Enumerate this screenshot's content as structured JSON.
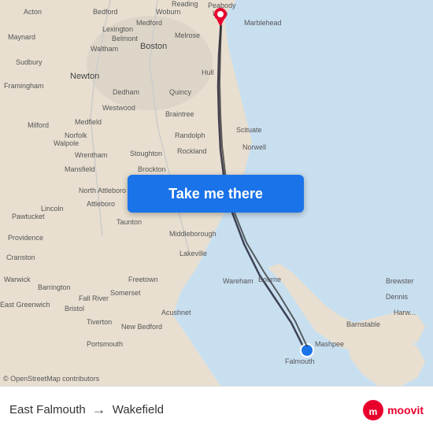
{
  "map": {
    "background_color": "#e8dfd0",
    "water_color": "#b8d4e8",
    "route_line_color": "#333333",
    "origin_marker_color": "#e8002d",
    "destination_marker_color": "#1a73e8"
  },
  "button": {
    "label": "Take me there",
    "bg_color": "#1a73e8",
    "text_color": "#ffffff"
  },
  "bottom_bar": {
    "from": "East Falmouth",
    "arrow": "→",
    "to": "Wakefield",
    "logo_text": "moovit"
  },
  "copyright": "© OpenStreetMap contributors",
  "annotations": {
    "newton_label": "Newton"
  }
}
